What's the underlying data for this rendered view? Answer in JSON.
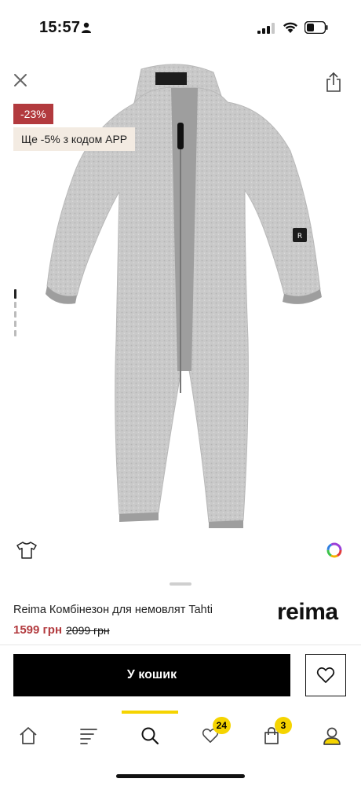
{
  "status_bar": {
    "time": "15:57",
    "icons": [
      "person-icon",
      "signal-icon",
      "wifi-icon",
      "battery-icon"
    ]
  },
  "gallery": {
    "discount_badge": "-23%",
    "promo_badge": "Ще -5% з кодом APP",
    "image_count": 5,
    "active_image_index": 0,
    "image_subject": "grey knit fleece baby overall with zip",
    "icons": [
      "close-icon",
      "share-icon",
      "tshirt-size-icon",
      "color-wheel-icon"
    ]
  },
  "product": {
    "title": "Reima Комбінезон для немовлят Tahti",
    "price_current": "1599 грн",
    "price_old": "2099 грн",
    "brand_logo_text": "reima"
  },
  "actions": {
    "cart_label": "У кошик",
    "wishlist_icon": "heart-icon"
  },
  "nav": {
    "items": [
      {
        "name": "home",
        "icon": "home-icon"
      },
      {
        "name": "catalog",
        "icon": "menu-icon"
      },
      {
        "name": "search",
        "icon": "search-icon",
        "active": true
      },
      {
        "name": "wishlist",
        "icon": "heart-icon",
        "badge": "24"
      },
      {
        "name": "cart",
        "icon": "bag-icon",
        "badge": "3"
      },
      {
        "name": "profile",
        "icon": "user-icon"
      }
    ]
  },
  "colors": {
    "accent": "#f5d400",
    "sale_red": "#b23a3e",
    "promo_bg": "#f3ebe2",
    "primary_button": "#000000"
  }
}
